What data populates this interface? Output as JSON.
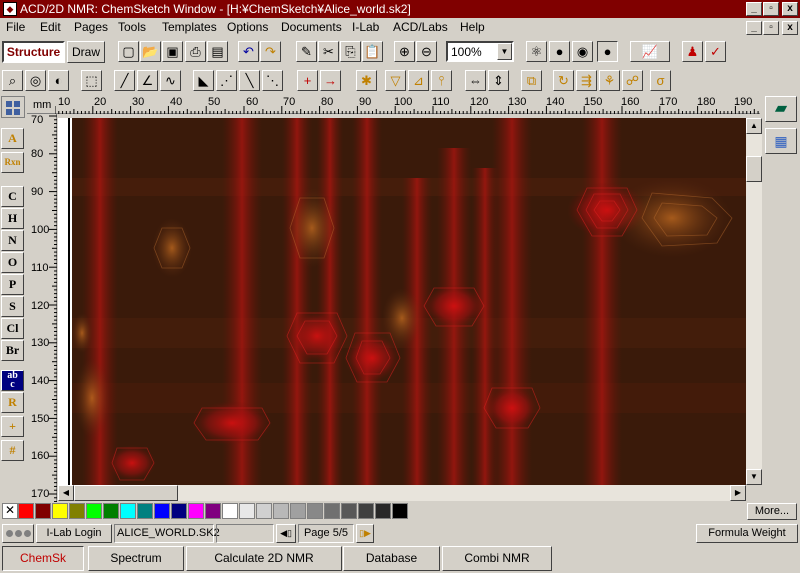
{
  "window": {
    "title": "ACD/2D NMR: ChemSketch Window - [H:¥ChemSketch¥Alice_world.sk2]",
    "controls": {
      "minimize": "_",
      "restore": "▫",
      "close": "x"
    }
  },
  "menu": [
    "File",
    "Edit",
    "Pages",
    "Tools",
    "Templates",
    "Options",
    "Documents",
    "I-Lab",
    "ACD/Labs",
    "Help"
  ],
  "mode_tabs": {
    "structure": "Structure",
    "draw": "Draw"
  },
  "zoom": {
    "value": "100%"
  },
  "ruler": {
    "unit": "mm",
    "x_ticks": [
      "10",
      "20",
      "30",
      "40",
      "50",
      "60",
      "70",
      "80",
      "90",
      "100",
      "110",
      "120",
      "130",
      "140",
      "150",
      "160",
      "170",
      "180",
      "190"
    ],
    "y_ticks": [
      "70",
      "80",
      "90",
      "100",
      "110",
      "120",
      "130",
      "140",
      "150",
      "160",
      "170"
    ]
  },
  "elements": [
    "C",
    "H",
    "N",
    "O",
    "P",
    "S",
    "Cl",
    "Br"
  ],
  "left_tools": {
    "atom_a": "A",
    "rxn": "Rxn",
    "text_tool": "ab\nc",
    "r_tool": "R",
    "plus_tool": "+",
    "grid_tool": "#"
  },
  "palette": {
    "colors": [
      "#ffffff",
      "#ff0000",
      "#800000",
      "#ffff00",
      "#808000",
      "#00ff00",
      "#008000",
      "#00ffff",
      "#008080",
      "#0000ff",
      "#000080",
      "#ff00ff",
      "#800080",
      "#ffffff",
      "#e8e8e8",
      "#d0d0d0",
      "#b8b8b8",
      "#a0a0a0",
      "#888888",
      "#707070",
      "#585858",
      "#404040",
      "#282828",
      "#000000"
    ],
    "more_label": "More..."
  },
  "status": {
    "ilab_login": "I-Lab Login",
    "document": "ALICE_WORLD.SK2",
    "page": "Page 5/5",
    "formula_weight": "Formula Weight"
  },
  "bottom_buttons": [
    "ChemSk",
    "Spectrum",
    "Calculate 2D NMR",
    "Database",
    "Combi NMR"
  ]
}
